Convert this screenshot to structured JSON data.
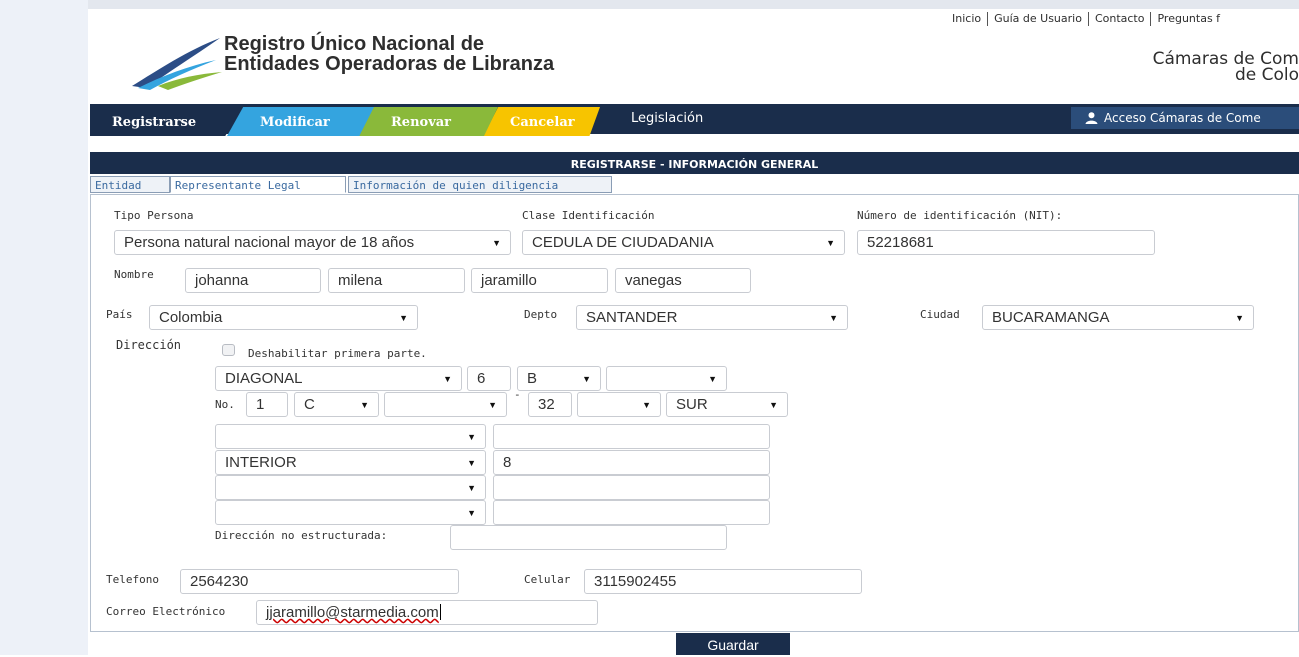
{
  "header": {
    "title_line1": "Registro Único Nacional de",
    "title_line2": "Entidades Operadoras de Libranza",
    "links": [
      "Inicio",
      "Guía de Usuario",
      "Contacto",
      "Preguntas f"
    ],
    "camaras_line1": "Cámaras de Com",
    "camaras_line2": "de Colo"
  },
  "nav": {
    "registrarse": "Registrarse",
    "modificar": "Modificar",
    "renovar": "Renovar",
    "cancelar": "Cancelar",
    "legislacion": "Legislación",
    "acceso": "Acceso Cámaras de Come"
  },
  "section_title": "REGISTRARSE - INFORMACIÓN GENERAL",
  "subtabs": [
    "Entidad",
    "Representante Legal",
    "Información de quien diligencia"
  ],
  "form": {
    "tipo_persona_label": "Tipo Persona",
    "tipo_persona_value": "Persona natural nacional mayor de 18 años",
    "clase_id_label": "Clase Identificación",
    "clase_id_value": "CEDULA DE CIUDADANIA",
    "nit_label": "Número de identificación (NIT):",
    "nit_value": "52218681",
    "nombre_label": "Nombre",
    "nombre1": "johanna",
    "nombre2": "milena",
    "apellido1": "jaramillo",
    "apellido2": "vanegas",
    "pais_label": "País",
    "pais_value": "Colombia",
    "depto_label": "Depto",
    "depto_value": "SANTANDER",
    "ciudad_label": "Ciudad",
    "ciudad_value": "BUCARAMANGA",
    "direccion_label": "Dirección",
    "deshabilitar_label": "Deshabilitar primera parte.",
    "dir_via": "DIAGONAL",
    "dir_num": "6",
    "dir_letra": "B",
    "dir_bis": "",
    "no_label": "No.",
    "dir_no1": "1",
    "dir_letra2": "C",
    "dir_bis2": "",
    "dir_dash": "-",
    "dir_no2": "32",
    "dir_letra3": "",
    "dir_cuadrante": "SUR",
    "comp1_sel": "",
    "comp1_val": "",
    "comp2_sel": "INTERIOR",
    "comp2_val": "8",
    "comp3_sel": "",
    "comp3_val": "",
    "comp4_sel": "",
    "comp4_val": "",
    "dir_no_estructurada_label": "Dirección no estructurada:",
    "dir_no_estructurada_value": "",
    "telefono_label": "Telefono",
    "telefono_value": "2564230",
    "celular_label": "Celular",
    "celular_value": "3115902455",
    "correo_label": "Correo Electrónico",
    "correo_value": "jjaramillo@starmedia.com"
  },
  "guardar": "Guardar",
  "colors": {
    "navy": "#1a2d4b",
    "blue": "#34a4df",
    "green": "#8ab93a",
    "yellow": "#f7c400"
  }
}
